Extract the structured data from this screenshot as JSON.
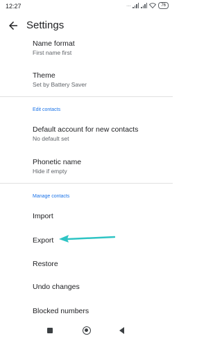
{
  "status_bar": {
    "time": "12:27",
    "battery": "76"
  },
  "app_bar": {
    "title": "Settings"
  },
  "items": {
    "name_format": {
      "title": "Name format",
      "subtitle": "First name first"
    },
    "theme": {
      "title": "Theme",
      "subtitle": "Set by Battery Saver"
    },
    "edit_contacts_header": "Edit contacts",
    "default_account": {
      "title": "Default account for new contacts",
      "subtitle": "No default set"
    },
    "phonetic_name": {
      "title": "Phonetic name",
      "subtitle": "Hide if empty"
    },
    "manage_contacts_header": "Manage contacts",
    "import": {
      "title": "Import"
    },
    "export": {
      "title": "Export"
    },
    "restore": {
      "title": "Restore"
    },
    "undo_changes": {
      "title": "Undo changes"
    },
    "blocked_numbers": {
      "title": "Blocked numbers"
    }
  },
  "colors": {
    "accent": "#1a73e8",
    "annotation_arrow": "#2ec4c4"
  },
  "icons": [
    "back-arrow-icon",
    "signal-icon",
    "wifi-icon",
    "battery-icon",
    "recents-icon",
    "home-icon",
    "back-icon"
  ]
}
